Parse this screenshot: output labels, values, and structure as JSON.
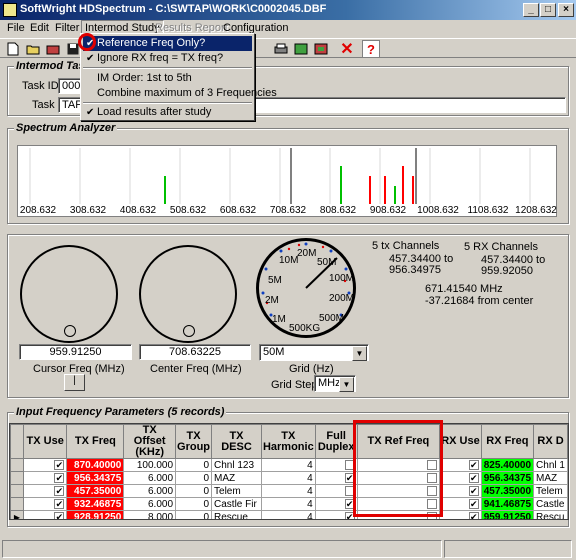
{
  "window": {
    "title": "SoftWright HDSpectrum - C:\\SWTAP\\WORK\\C0002045.DBF"
  },
  "menubar": {
    "items": [
      "File",
      "Edit",
      "Filter",
      "Intermod Study",
      "Results Report",
      "Configuration"
    ]
  },
  "intermod_menu": {
    "items": [
      {
        "label": "Reference Freq Only?",
        "checked": true,
        "selected": true
      },
      {
        "label": "Ignore RX freq = TX freq?",
        "checked": true
      },
      {
        "label": "IM Order: 1st to 5th"
      },
      {
        "label": "Combine maximum of 3 Frequencies"
      },
      {
        "label": "Load results after study",
        "checked": true
      }
    ]
  },
  "intermod_task": {
    "title": "Intermod Task",
    "task_id_label": "Task ID:",
    "task_id_value": "0002",
    "task_label": "Task",
    "task_value": "TAP"
  },
  "spectrum": {
    "title": "Spectrum Analyzer",
    "ticks": [
      "208.632",
      "308.632",
      "408.632",
      "508.632",
      "608.632",
      "708.632",
      "808.632",
      "908.632",
      "1008.632",
      "1108.632",
      "1208.632"
    ]
  },
  "controls": {
    "cursor_freq_value": "959.91250",
    "cursor_freq_label": "Cursor Freq (MHz)",
    "center_freq_value": "708.63225",
    "center_freq_label": "Center Freq (MHz)",
    "grid_value": "50M",
    "grid_label": "Grid (Hz)",
    "grid_step_label": "Grid Step",
    "grid_step_value": "MHz",
    "center_button_label": "|",
    "dial_labels": [
      "10M",
      "20M",
      "50M",
      "100M",
      "200M",
      "500M",
      "500KG",
      "1M",
      "2M",
      "5M"
    ]
  },
  "info": {
    "tx_channels": "5 tx Channels",
    "tx_range_1": "457.34400 to",
    "tx_range_2": "956.34975",
    "rx_channels": "5 RX Channels",
    "rx_range_1": "457.34400 to",
    "rx_range_2": "959.92050",
    "cursor_mhz": "671.41540 MHz",
    "from_center": "-37.21684 from center"
  },
  "input_params": {
    "title": "Input Frequency Parameters (5 records)",
    "columns": [
      "TX Use",
      "TX Freq",
      "TX Offset (KHz)",
      "TX Group",
      "TX DESC",
      "TX Harmonic",
      "Full Duplex",
      "TX Ref Freq",
      "RX Use",
      "RX Freq",
      "RX D"
    ],
    "rows": [
      {
        "tx_freq": "870.40000",
        "offset": "100.000",
        "group": "0",
        "desc": "Chnl 123",
        "harmonic": "4",
        "full_duplex": false,
        "rx_freq": "825.40000",
        "rx_desc": "Chnl 1"
      },
      {
        "tx_freq": "956.34375",
        "offset": "6.000",
        "group": "0",
        "desc": "MAZ",
        "harmonic": "4",
        "full_duplex": true,
        "rx_freq": "956.34375",
        "rx_desc": "MAZ"
      },
      {
        "tx_freq": "457.35000",
        "offset": "6.000",
        "group": "0",
        "desc": "Telem",
        "harmonic": "4",
        "full_duplex": false,
        "rx_freq": "457.35000",
        "rx_desc": "Telem"
      },
      {
        "tx_freq": "932.46875",
        "offset": "6.000",
        "group": "0",
        "desc": "Castle Fir",
        "harmonic": "4",
        "full_duplex": true,
        "rx_freq": "941.46875",
        "rx_desc": "Castle"
      },
      {
        "tx_freq": "928.91250",
        "offset": "8.000",
        "group": "0",
        "desc": "Rescue",
        "harmonic": "4",
        "full_duplex": true,
        "rx_freq": "959.91250",
        "rx_desc": "Rescu"
      }
    ]
  }
}
